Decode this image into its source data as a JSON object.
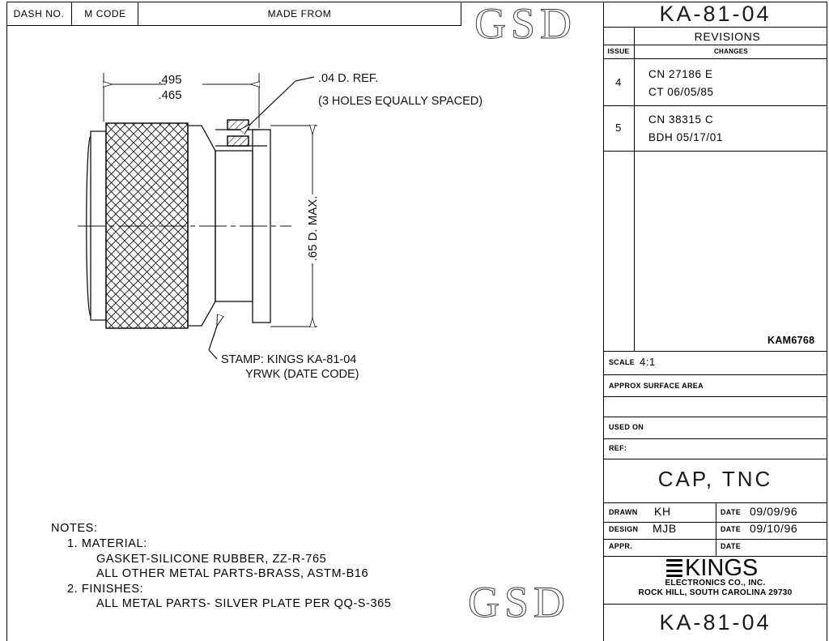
{
  "sheet": {
    "watermark": "GSD",
    "part_number": "KA-81-04"
  },
  "header_table": {
    "columns": [
      {
        "label": "DASH NO."
      },
      {
        "label": "M CODE"
      },
      {
        "label": "MADE FROM"
      }
    ]
  },
  "revisions": {
    "title": "REVISIONS",
    "col_issue": "ISSUE",
    "col_changes": "CHANGES",
    "rows": [
      {
        "issue": "4",
        "line1": "CN  27186  E",
        "line2": "CT    06/05/85"
      },
      {
        "issue": "5",
        "line1": "CN  38315  C",
        "line2": "BDH  05/17/01"
      }
    ],
    "doc_code": "KAM6768"
  },
  "title_block": {
    "scale_label": "SCALE",
    "scale_value": "4:1",
    "approx_surface_area_label": "APPROX  SURFACE  AREA",
    "approx_surface_area_value": "",
    "used_on_label": "USED ON",
    "used_on_value": "",
    "ref_label": "REF:",
    "ref_value": "",
    "description": "CAP,  TNC",
    "drawn_label": "DRAWN",
    "drawn_value": "KH",
    "drawn_date_label": "DATE",
    "drawn_date_value": "09/09/96",
    "design_label": "DESIGN",
    "design_value": "MJB",
    "design_date_label": "DATE",
    "design_date_value": "09/10/96",
    "appr_label": "APPR.",
    "appr_value": "",
    "appr_date_label": "DATE",
    "appr_date_value": "",
    "company_name": "KINGS",
    "company_line1": "ELECTRONICS  CO.,  INC.",
    "company_line2": "ROCK  HILL,  SOUTH  CAROLINA  29730",
    "bottom_part_number": "KA-81-04"
  },
  "drawing": {
    "dim_length_max": ".495",
    "dim_length_min": ".465",
    "dim_hole": ".04 D. REF.",
    "dim_hole_note": "(3 HOLES EQUALLY SPACED)",
    "dim_diameter": ".65 D. MAX.",
    "stamp_line1": "STAMP: KINGS KA-81-04",
    "stamp_line2": "YRWK (DATE CODE)"
  },
  "notes": {
    "heading": "NOTES:",
    "items": [
      "1. MATERIAL:",
      "GASKET-SILICONE RUBBER, ZZ-R-765",
      "ALL OTHER METAL PARTS-BRASS, ASTM-B16",
      "2. FINISHES:",
      "ALL METAL PARTS-  SILVER PLATE PER QQ-S-365"
    ]
  }
}
